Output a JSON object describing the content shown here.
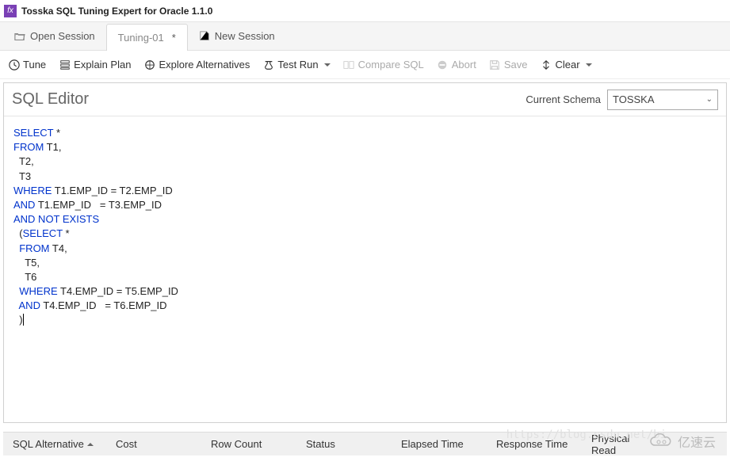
{
  "title": "Tosska SQL Tuning Expert for Oracle 1.1.0",
  "tabs": {
    "open_session": "Open Session",
    "tuning": "Tuning-01",
    "tuning_dirty": "*",
    "new_session": "New Session"
  },
  "toolbar": {
    "tune": "Tune",
    "explain_plan": "Explain Plan",
    "explore_alt": "Explore Alternatives",
    "test_run": "Test Run",
    "compare_sql": "Compare SQL",
    "abort": "Abort",
    "save": "Save",
    "clear": "Clear"
  },
  "editor": {
    "title": "SQL Editor",
    "schema_label": "Current Schema",
    "schema_value": "TOSSKA"
  },
  "sql": {
    "l1_kw": "SELECT",
    "l1_rest": " *",
    "l2_kw": "FROM",
    "l2_rest": " T1,",
    "l3": "  T2,",
    "l4": "  T3",
    "l5_kw": "WHERE",
    "l5_rest": " T1.EMP_ID = T2.EMP_ID",
    "l6_kw": "AND",
    "l6_rest": " T1.EMP_ID   = T3.EMP_ID",
    "l7_kw": "AND NOT EXISTS",
    "l8_pre": "  (",
    "l8_kw": "SELECT",
    "l8_rest": " *",
    "l9_pre": "  ",
    "l9_kw": "FROM",
    "l9_rest": " T4,",
    "l10": "    T5,",
    "l11": "    T6",
    "l12_pre": "  ",
    "l12_kw": "WHERE",
    "l12_rest": " T4.EMP_ID = T5.EMP_ID",
    "l13_pre": "  ",
    "l13_kw": "AND",
    "l13_rest": " T4.EMP_ID   = T6.EMP_ID",
    "l14": "  )"
  },
  "grid": {
    "c1": "SQL Alternative",
    "c2": "Cost",
    "c3": "Row Count",
    "c4": "Status",
    "c5": "Elapsed Time",
    "c6": "Response Time",
    "c7": "Physical Read"
  },
  "watermark": {
    "text": "亿速云",
    "url": "https://blog.csdn.net/bi"
  }
}
